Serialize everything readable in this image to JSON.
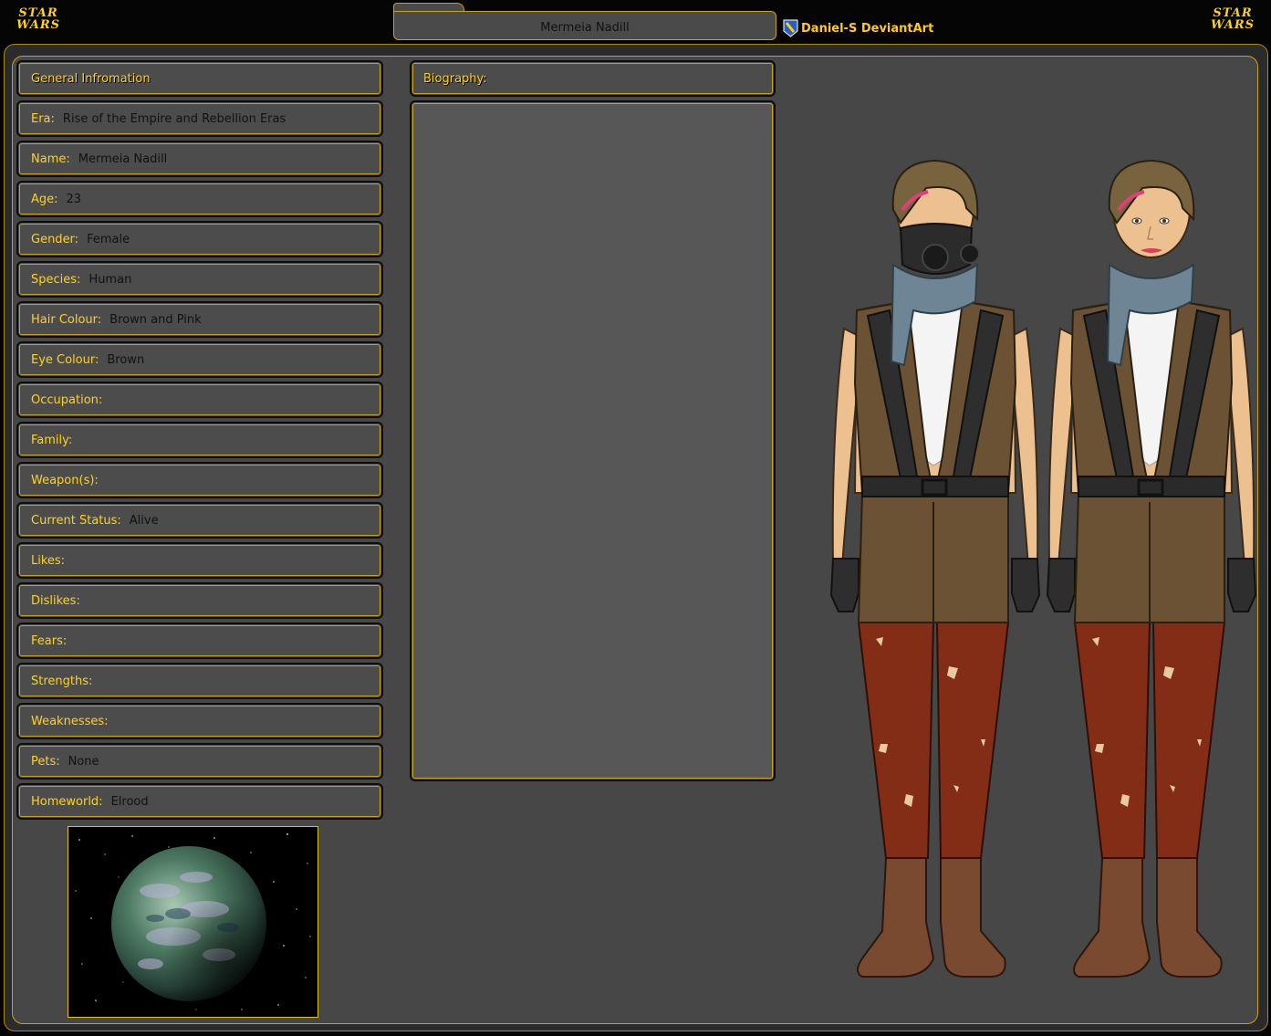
{
  "brand": {
    "logo_line1": "STAR",
    "logo_line2": "WARS"
  },
  "title": "Mermeia Nadill",
  "credit": {
    "text": "Daniel-S DeviantArt",
    "icon": "deviantart-icon"
  },
  "info": {
    "header": "General Infromation",
    "fields": [
      {
        "label": "Era:",
        "value": "Rise of the Empire and Rebellion Eras"
      },
      {
        "label": "Name:",
        "value": "Mermeia Nadill"
      },
      {
        "label": "Age:",
        "value": "23"
      },
      {
        "label": "Gender:",
        "value": "Female"
      },
      {
        "label": "Species:",
        "value": "Human"
      },
      {
        "label": "Hair Colour:",
        "value": "Brown and Pink"
      },
      {
        "label": "Eye Colour:",
        "value": "Brown"
      },
      {
        "label": "Occupation:",
        "value": ""
      },
      {
        "label": "Family:",
        "value": ""
      },
      {
        "label": "Weapon(s):",
        "value": ""
      },
      {
        "label": "Current Status:",
        "value": "Alive"
      },
      {
        "label": "Likes:",
        "value": ""
      },
      {
        "label": "Dislikes:",
        "value": ""
      },
      {
        "label": "Fears:",
        "value": ""
      },
      {
        "label": "Strengths:",
        "value": ""
      },
      {
        "label": "Weaknesses:",
        "value": ""
      },
      {
        "label": "Pets:",
        "value": "None"
      },
      {
        "label": "Homeworld:",
        "value": "Elrood"
      }
    ]
  },
  "biography": {
    "header": "Biography:",
    "text": ""
  },
  "colors": {
    "accent": "#ffd21a",
    "border": "#c8a21a",
    "panel": "#474747",
    "field": "#4c4c4c"
  }
}
